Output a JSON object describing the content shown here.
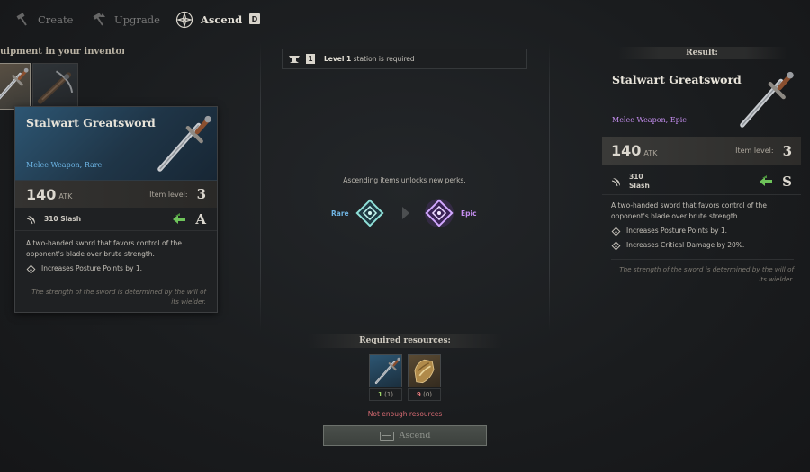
{
  "tabs": [
    {
      "label": "Create",
      "icon": "hammer-icon",
      "active": false
    },
    {
      "label": "Upgrade",
      "icon": "hammer-up-icon",
      "active": false
    },
    {
      "label": "Ascend",
      "icon": "ascend-star-icon",
      "active": true
    }
  ],
  "tab_key_hint": "D",
  "inventory": {
    "header": "uipment in your inventory",
    "slots": [
      {
        "item": "Stalwart Greatsword",
        "icon": "greatsword-icon",
        "selected": true
      },
      {
        "item": "",
        "icon": "crossbow-icon",
        "selected": false
      }
    ]
  },
  "current_item": {
    "name": "Stalwart Greatsword",
    "type": "Melee Weapon, Rare",
    "atk": "140",
    "atk_unit": "ATK",
    "item_level_label": "Item level:",
    "item_level": "3",
    "damage": "310 Slash",
    "grade": "A",
    "description": "A two-handed sword that favors control of the opponent's blade over brute strength.",
    "perks": [
      "Increases Posture Points by 1."
    ],
    "lore": "The strength of the sword is determined by the will of its wielder."
  },
  "station": {
    "level": "1",
    "level_text": "Level 1",
    "suffix": " station is required"
  },
  "ascend_info": {
    "text": "Ascending items unlocks new perks.",
    "from_rarity": "Rare",
    "to_rarity": "Epic"
  },
  "resources": {
    "title": "Required resources:",
    "items": [
      {
        "icon": "greatsword-icon",
        "required": "1",
        "owned": "(1)",
        "enough": true
      },
      {
        "icon": "gauntlet-material-icon",
        "required": "9",
        "owned": "(0)",
        "enough": false
      }
    ],
    "warning": "Not enough resources",
    "button_label": "Ascend"
  },
  "result": {
    "title": "Result:",
    "name": "Stalwart Greatsword",
    "type": "Melee Weapon, Epic",
    "atk": "140",
    "atk_unit": "ATK",
    "item_level_label": "Item level:",
    "item_level": "3",
    "damage_value": "310",
    "damage_type": "Slash",
    "grade": "S",
    "description": "A two-handed sword that favors control of the opponent's blade over brute strength.",
    "perks": [
      "Increases Posture Points by 1.",
      "Increases Critical Damage by 20%."
    ],
    "lore": "The strength of the sword is determined by the will of its wielder."
  },
  "colors": {
    "rare": "#6fb3e0",
    "epic": "#c58ef0",
    "ok": "#9ed36a",
    "warning": "#d66a72"
  }
}
